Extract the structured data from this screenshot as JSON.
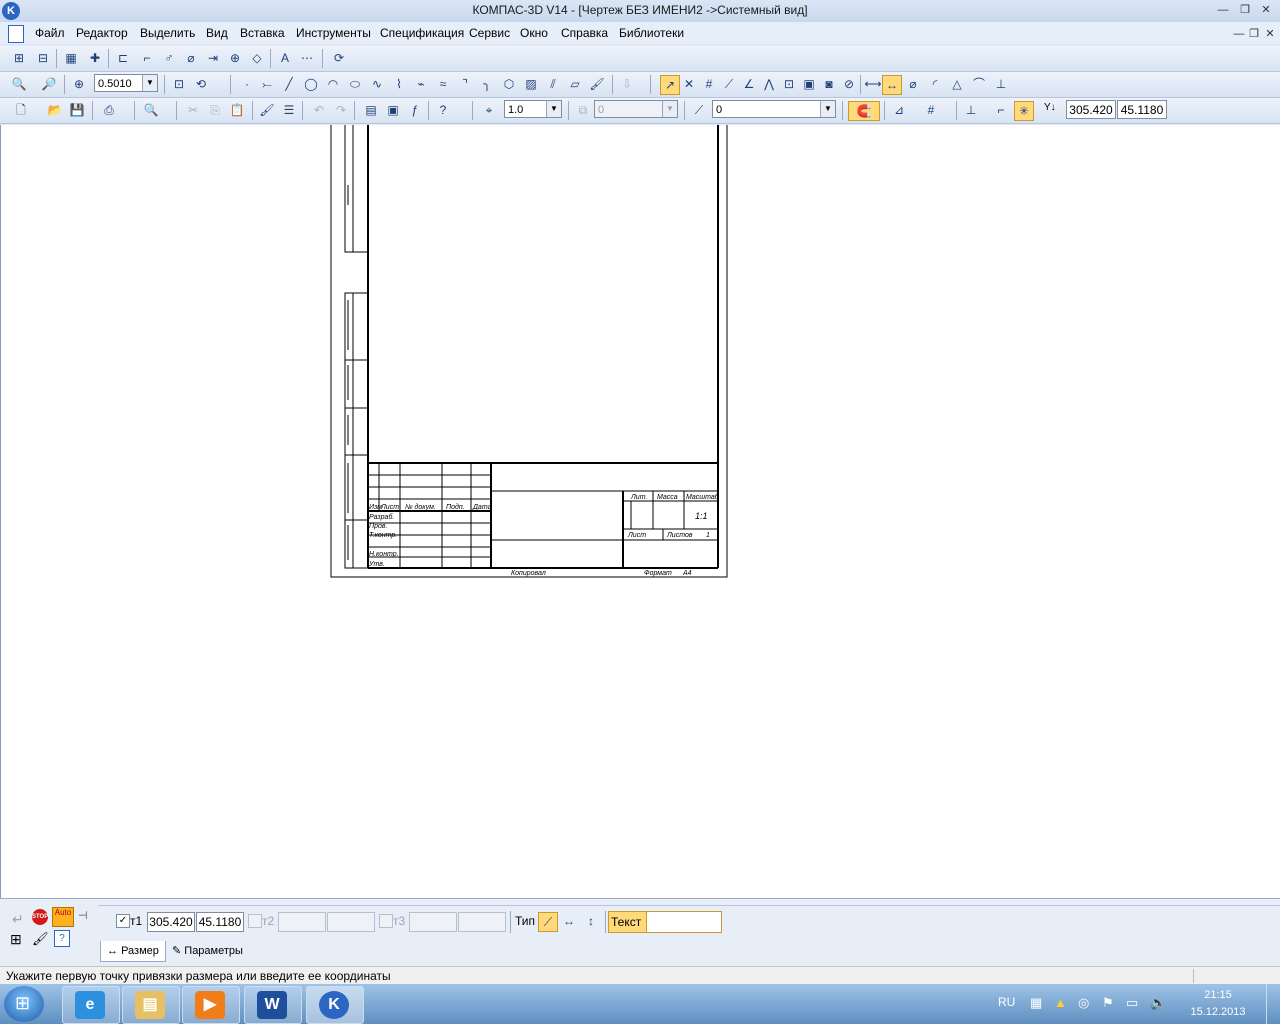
{
  "window": {
    "title": "КОМПАС-3D V14 - [Чертеж БЕЗ ИМЕНИ2 ->Системный вид]",
    "app_icon_letter": "K"
  },
  "menu": [
    "Файл",
    "Редактор",
    "Выделить",
    "Вид",
    "Вставка",
    "Инструменты",
    "Спецификация",
    "Сервис",
    "Окно",
    "Справка",
    "Библиотеки"
  ],
  "toolbar_view": {
    "zoom_value": "0.5010"
  },
  "toolbar_standard": {
    "step_value": "1.0",
    "layer_value": "0",
    "style_value": "0",
    "cursor_x": "305.420",
    "cursor_y": "45.1180",
    "cursor_axis_label": "Y↓"
  },
  "drawing": {
    "col_headers": [
      "Изм",
      "Лист",
      "№ докум.",
      "Подп.",
      "Дата"
    ],
    "row_labels": [
      "Разраб.",
      "Пров.",
      "Т.контр.",
      "Н.контр.",
      "Утв."
    ],
    "right_headers": [
      "Лит.",
      "Масса",
      "Масштаб"
    ],
    "scale": "1:1",
    "sheet_label": "Лист",
    "sheets_label": "Листов",
    "sheets_value": "1",
    "copied_label": "Копировал",
    "format_label": "Формат",
    "format_value": "A4"
  },
  "properties": {
    "t1_label": "т1",
    "t1_x": "305.420",
    "t1_y": "45.1180",
    "t2_label": "т2",
    "t3_label": "т3",
    "type_label": "Тип",
    "text_label": "Текст",
    "text_value": "",
    "tab_size": "Размер",
    "tab_params": "Параметры",
    "auto_label": "Auto",
    "stop_label": "STOP"
  },
  "status": {
    "message": "Укажите первую точку привязки размера или введите ее координаты"
  },
  "taskbar": {
    "lang": "RU",
    "time": "21:15",
    "date": "15.12.2013",
    "apps": [
      "ie-icon",
      "explorer-icon",
      "media-icon",
      "word-icon",
      "kompas-icon"
    ]
  },
  "colors": {
    "accent": "#2c66c3",
    "highlight": "#ffd97a"
  }
}
